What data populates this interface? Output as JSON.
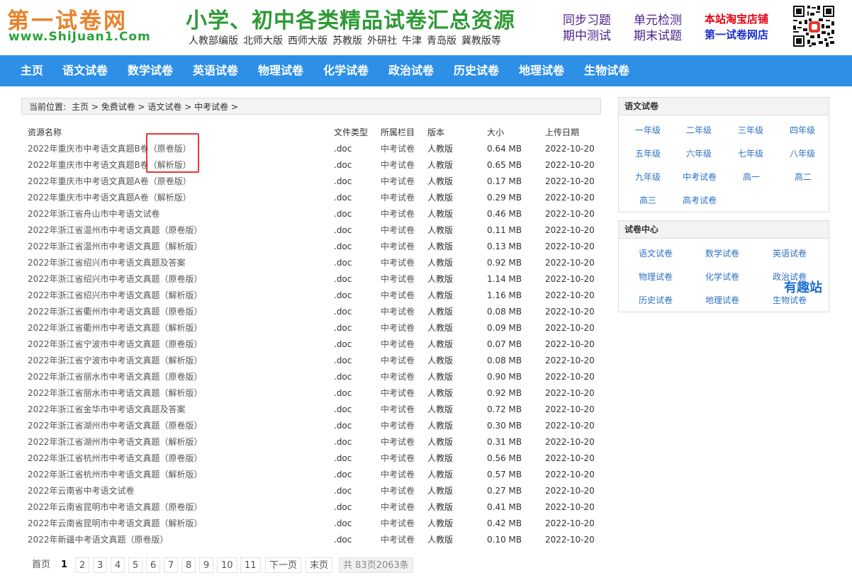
{
  "header": {
    "logo_main": "第一试卷网",
    "logo_url": "www.ShiJuan1.Com",
    "slogan": "小学、初中各类精品试卷汇总资源",
    "versions": [
      "人教部编版",
      "北师大版",
      "西师大版",
      "苏教版",
      "外研社",
      "牛津",
      "青岛版",
      "冀教版等"
    ],
    "tags": [
      "同步习题",
      "期中测试",
      "单元检测",
      "期末试题"
    ],
    "taobao_line1": "本站淘宝店铺",
    "taobao_line2": "第一试卷网店"
  },
  "nav": [
    "主页",
    "语文试卷",
    "数学试卷",
    "英语试卷",
    "物理试卷",
    "化学试卷",
    "政治试卷",
    "历史试卷",
    "地理试卷",
    "生物试卷"
  ],
  "breadcrumb": {
    "label": "当前位置:",
    "path": "主页 > 免费试卷 > 语文试卷 > 中考试卷 >"
  },
  "table": {
    "headers": [
      "资源名称",
      "文件类型",
      "所属栏目",
      "版本",
      "大小",
      "上传日期"
    ],
    "rows": [
      [
        "2022年重庆市中考语文真题B卷（原卷版）",
        ".doc",
        "中考试卷",
        "人教版",
        "0.64 MB",
        "2022-10-20"
      ],
      [
        "2022年重庆市中考语文真题B卷（解析版）",
        ".doc",
        "中考试卷",
        "人教版",
        "0.65 MB",
        "2022-10-20"
      ],
      [
        "2022年重庆市中考语文真题A卷（原卷版）",
        ".doc",
        "中考试卷",
        "人教版",
        "0.17 MB",
        "2022-10-20"
      ],
      [
        "2022年重庆市中考语文真题A卷（解析版）",
        ".doc",
        "中考试卷",
        "人教版",
        "0.29 MB",
        "2022-10-20"
      ],
      [
        "2022年浙江省舟山市中考语文试卷",
        ".doc",
        "中考试卷",
        "人教版",
        "0.46 MB",
        "2022-10-20"
      ],
      [
        "2022年浙江省温州市中考语文真题（原卷版）",
        ".doc",
        "中考试卷",
        "人教版",
        "0.11 MB",
        "2022-10-20"
      ],
      [
        "2022年浙江省温州市中考语文真题（解析版）",
        ".doc",
        "中考试卷",
        "人教版",
        "0.13 MB",
        "2022-10-20"
      ],
      [
        "2022年浙江省绍兴市中考语文真题及答案",
        ".doc",
        "中考试卷",
        "人教版",
        "0.92 MB",
        "2022-10-20"
      ],
      [
        "2022年浙江省绍兴市中考语文真题（原卷版）",
        ".doc",
        "中考试卷",
        "人教版",
        "1.14 MB",
        "2022-10-20"
      ],
      [
        "2022年浙江省绍兴市中考语文真题（解析版）",
        ".doc",
        "中考试卷",
        "人教版",
        "1.16 MB",
        "2022-10-20"
      ],
      [
        "2022年浙江省衢州市中考语文真题（原卷版）",
        ".doc",
        "中考试卷",
        "人教版",
        "0.08 MB",
        "2022-10-20"
      ],
      [
        "2022年浙江省衢州市中考语文真题（解析版）",
        ".doc",
        "中考试卷",
        "人教版",
        "0.09 MB",
        "2022-10-20"
      ],
      [
        "2022年浙江省宁波市中考语文真题（原卷版）",
        ".doc",
        "中考试卷",
        "人教版",
        "0.07 MB",
        "2022-10-20"
      ],
      [
        "2022年浙江省宁波市中考语文真题（解析版）",
        ".doc",
        "中考试卷",
        "人教版",
        "0.08 MB",
        "2022-10-20"
      ],
      [
        "2022年浙江省丽水市中考语文真题（原卷版）",
        ".doc",
        "中考试卷",
        "人教版",
        "0.90 MB",
        "2022-10-20"
      ],
      [
        "2022年浙江省丽水市中考语文真题（解析版）",
        ".doc",
        "中考试卷",
        "人教版",
        "0.92 MB",
        "2022-10-20"
      ],
      [
        "2022年浙江省金华市中考语文真题及答案",
        ".doc",
        "中考试卷",
        "人教版",
        "0.72 MB",
        "2022-10-20"
      ],
      [
        "2022年浙江省湖州市中考语文真题（原卷版）",
        ".doc",
        "中考试卷",
        "人教版",
        "0.30 MB",
        "2022-10-20"
      ],
      [
        "2022年浙江省湖州市中考语文真题（解析版）",
        ".doc",
        "中考试卷",
        "人教版",
        "0.31 MB",
        "2022-10-20"
      ],
      [
        "2022年浙江省杭州市中考语文真题（原卷版）",
        ".doc",
        "中考试卷",
        "人教版",
        "0.56 MB",
        "2022-10-20"
      ],
      [
        "2022年浙江省杭州市中考语文真题（解析版）",
        ".doc",
        "中考试卷",
        "人教版",
        "0.57 MB",
        "2022-10-20"
      ],
      [
        "2022年云南省中考语文试卷",
        ".doc",
        "中考试卷",
        "人教版",
        "0.27 MB",
        "2022-10-20"
      ],
      [
        "2022年云南省昆明市中考语文真题（原卷版）",
        ".doc",
        "中考试卷",
        "人教版",
        "0.41 MB",
        "2022-10-20"
      ],
      [
        "2022年云南省昆明市中考语文真题（解析版）",
        ".doc",
        "中考试卷",
        "人教版",
        "0.42 MB",
        "2022-10-20"
      ],
      [
        "2022年新疆中考语文真题（原卷版）",
        ".doc",
        "中考试卷",
        "人教版",
        "0.10 MB",
        "2022-10-20"
      ]
    ]
  },
  "pagination": {
    "first": "首页",
    "pages": [
      "1",
      "2",
      "3",
      "4",
      "5",
      "6",
      "7",
      "8",
      "9",
      "10",
      "11"
    ],
    "current": "1",
    "next": "下一页",
    "last": "末页",
    "info": "共 83页2063条"
  },
  "sidebar": {
    "chinese": {
      "title": "语文试卷",
      "links": [
        "一年级",
        "二年级",
        "三年级",
        "四年级",
        "五年级",
        "六年级",
        "七年级",
        "八年级",
        "九年级",
        "中考试卷",
        "高一",
        "高二",
        "高三",
        "高考试卷"
      ]
    },
    "center": {
      "title": "试卷中心",
      "links": [
        "语文试卷",
        "数学试卷",
        "英语试卷",
        "物理试卷",
        "化学试卷",
        "政治试卷",
        "历史试卷",
        "地理试卷",
        "生物试卷"
      ]
    },
    "watermark": "有趣站"
  },
  "colors": {
    "nav_bg": "#2d8fe6",
    "logo_orange": "#e8822a",
    "slogan_green": "#2e9a35",
    "tag_purple": "#4a1f8c",
    "highlight_red": "#e53935",
    "link_blue": "#2d72c4"
  },
  "icons": {
    "qr": "qr-code-icon"
  }
}
